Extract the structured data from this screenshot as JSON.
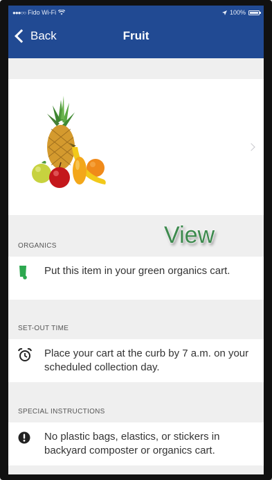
{
  "status_bar": {
    "carrier": "Fido Wi-Fi",
    "signal": "●●●○○",
    "battery": "100%"
  },
  "nav": {
    "back_label": "Back",
    "title": "Fruit"
  },
  "overlay": {
    "label": "View",
    "color": "#3d8a4e"
  },
  "sections": [
    {
      "header": "ORGANICS",
      "icon": "green-cart-icon",
      "text": "Put this item in your green organics cart."
    },
    {
      "header": "SET-OUT TIME",
      "icon": "alarm-clock-icon",
      "text": "Place your cart at the curb by 7 a.m. on your scheduled collection day."
    },
    {
      "header": "SPECIAL INSTRUCTIONS",
      "icon": "alert-icon",
      "text": "No plastic bags, elastics, or stickers in backyard composter or organics cart."
    }
  ],
  "colors": {
    "nav_bar": "#214a93",
    "organics_green": "#2ca84f",
    "background": "#efefef"
  }
}
